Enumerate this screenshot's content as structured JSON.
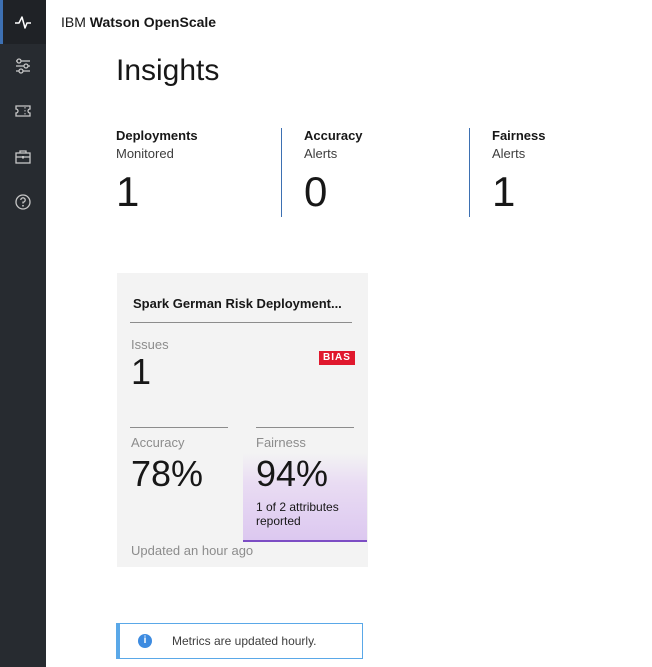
{
  "app": {
    "brand_prefix": "IBM",
    "brand_name": "Watson OpenScale"
  },
  "sidebar": {
    "items": [
      {
        "icon": "activity-pulse-icon",
        "active": true
      },
      {
        "icon": "sliders-icon",
        "active": false
      },
      {
        "icon": "ticket-icon",
        "active": false
      },
      {
        "icon": "briefcase-icon",
        "active": false
      },
      {
        "icon": "help-icon",
        "active": false
      }
    ]
  },
  "page": {
    "title": "Insights"
  },
  "stats": [
    {
      "title": "Deployments",
      "subtitle": "Monitored",
      "value": "1"
    },
    {
      "title": "Accuracy",
      "subtitle": "Alerts",
      "value": "0"
    },
    {
      "title": "Fairness",
      "subtitle": "Alerts",
      "value": "1"
    }
  ],
  "deployment_card": {
    "title": "Spark German Risk Deployment...",
    "issues_label": "Issues",
    "issues_value": "1",
    "badge": "BIAS",
    "accuracy_label": "Accuracy",
    "accuracy_value": "78%",
    "fairness_label": "Fairness",
    "fairness_value": "94%",
    "fairness_note_line1": "1 of 2 attributes",
    "fairness_note_line2": "reported",
    "updated": "Updated an hour ago"
  },
  "notification": {
    "message": "Metrics are updated hourly."
  },
  "colors": {
    "sidebar_bg": "#272b30",
    "accent_blue": "#3d70b2",
    "badge_red": "#e0182d",
    "fairness_purple": "#7c4dc4",
    "info_blue": "#5aa8e8"
  }
}
